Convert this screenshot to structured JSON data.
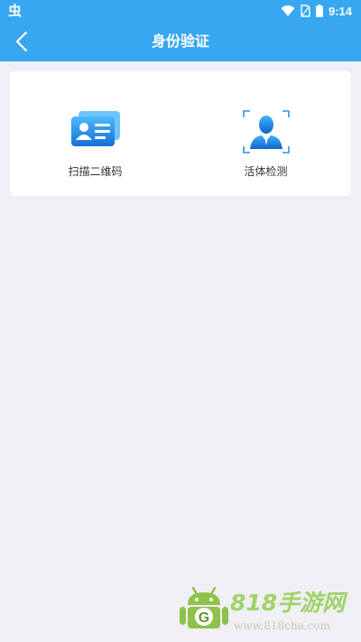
{
  "status_bar": {
    "app_glyph": "虫",
    "time": "9:14"
  },
  "header": {
    "title": "身份验证"
  },
  "options": [
    {
      "label": "扫描二维码",
      "icon": "id-card-icon"
    },
    {
      "label": "活体检测",
      "icon": "face-scan-icon"
    }
  ],
  "watermark": {
    "title": "818手游网",
    "url": "www.818cha.com"
  },
  "colors": {
    "accent": "#36a7f0",
    "background": "#efeff4",
    "card": "#ffffff",
    "watermark_green": "#9fd36a"
  }
}
